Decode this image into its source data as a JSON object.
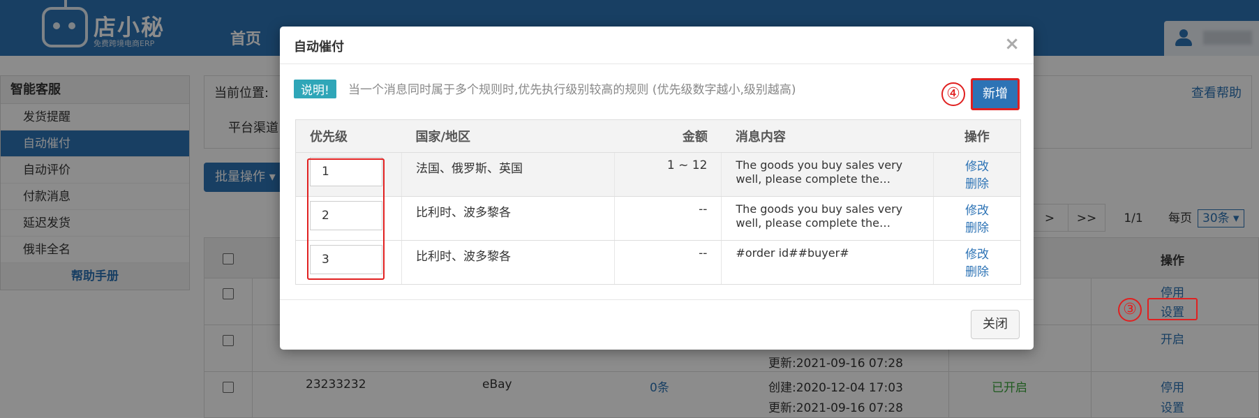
{
  "app": {
    "logo_name": "店小秘",
    "logo_subtitle": "免费跨境电商ERP",
    "nav_home": "首页"
  },
  "sidebar": {
    "title": "智能客服",
    "items": [
      {
        "label": "发货提醒"
      },
      {
        "label": "自动催付",
        "active": true
      },
      {
        "label": "自动评价"
      },
      {
        "label": "付款消息"
      },
      {
        "label": "延迟发货"
      },
      {
        "label": "俄非全名"
      }
    ],
    "help": "帮助手册"
  },
  "breadcrumb": {
    "label": "当前位置:",
    "help": "查看帮助",
    "channel": "平台渠道"
  },
  "toolbar": {
    "batch": "批量操作 ▾"
  },
  "pager": {
    "next": ">",
    "last": ">>",
    "page": "1/1",
    "per_page_label": "每页",
    "per_page_value": "30条 ▾"
  },
  "bg_table": {
    "header_op": "操作",
    "rows": [
      {
        "op1": "停用",
        "op2": "设置",
        "circle": "③"
      },
      {
        "updated": "更新:2021-09-16 07:28",
        "op1": "开启"
      },
      {
        "id": "23233232",
        "platform": "eBay",
        "count": "0条",
        "created": "创建:2020-12-04 17:03",
        "updated": "更新:2021-09-16 07:28",
        "status": "已开启",
        "op1": "停用",
        "op2": "设置"
      }
    ]
  },
  "modal": {
    "title": "自动催付",
    "close_icon": "×",
    "note_tag": "说明!",
    "note_text": "当一个消息同时属于多个规则时,优先执行级别较高的规则 (优先级数字越小,级别越高)",
    "add_circle": "④",
    "add_button": "新增",
    "columns": [
      "优先级",
      "国家/地区",
      "金额",
      "消息内容",
      "操作"
    ],
    "rules": [
      {
        "priority": "1",
        "region": "法国、俄罗斯、英国",
        "amount": "1 ~ 12",
        "message": "The goods you buy sales very well, please complete the payment ASAP",
        "edit": "修改",
        "delete": "删除"
      },
      {
        "priority": "2",
        "region": "比利时、波多黎各",
        "amount": "--",
        "message": "The goods you buy sales very well, please complete the payment ASAP",
        "edit": "修改",
        "delete": "删除"
      },
      {
        "priority": "3",
        "region": "比利时、波多黎各",
        "amount": "--",
        "message": "#order id##buyer#",
        "edit": "修改",
        "delete": "删除"
      }
    ],
    "close_button": "关闭"
  }
}
